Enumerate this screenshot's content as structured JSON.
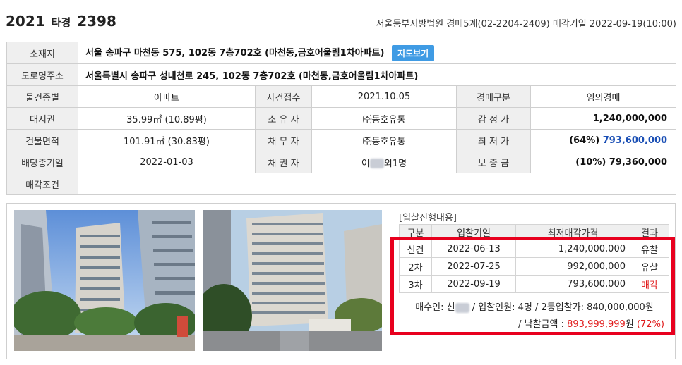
{
  "header": {
    "case_year": "2021",
    "case_type": "타경",
    "case_no": "2398",
    "court_info": "서울동부지방법원 경매5계(02-2204-2409) 매각기일 2022-09-19(10:00)"
  },
  "info": {
    "address_label": "소재지",
    "address": "서울 송파구 마천동 575, 102동 7층702호 (마천동,금호어울림1차아파트)",
    "map_button": "지도보기",
    "road_label": "도로명주소",
    "road_address": "서울특별시 송파구 성내천로 245, 102동 7층702호 (마천동,금호어울림1차아파트)",
    "row3": [
      "물건종별",
      "아파트",
      "사건접수",
      "2021.10.05",
      "경매구분",
      "임의경매"
    ],
    "row4": [
      "대지권",
      "35.99㎡ (10.89평)",
      "소 유 자",
      "㈜동호유통",
      "감 정 가",
      "1,240,000,000"
    ],
    "row5": [
      "건물면적",
      "101.91㎡ (30.83평)",
      "채 무 자",
      "㈜동호유통",
      "최 저 가",
      "(64%)",
      "793,600,000"
    ],
    "row6": [
      "배당종기일",
      "2022-01-03",
      "채 권 자",
      "이",
      "외1명",
      "보 증 금",
      "(10%) 79,360,000"
    ],
    "sale_cond_label": "매각조건",
    "sale_cond_value": ""
  },
  "bid": {
    "title": "[입찰진행내용]",
    "headers": [
      "구분",
      "입찰기일",
      "최저매각가격",
      "결과"
    ],
    "rows": [
      [
        "신건",
        "2022-06-13",
        "1,240,000,000",
        "유찰"
      ],
      [
        "2차",
        "2022-07-25",
        "992,000,000",
        "유찰"
      ],
      [
        "3차",
        "2022-09-19",
        "793,600,000",
        "매각"
      ]
    ],
    "buyer_prefix": "매수인: 신",
    "buyer_rest": " / 입찰인원: 4명 / 2등입찰가: 840,000,000원",
    "price_prefix": "/ 낙찰금액 : ",
    "price_value": "893,999,999",
    "price_unit": "원",
    "price_pct": "(72%)"
  },
  "colors": {
    "accent_blue": "#3f9be4",
    "highlight_red": "#e8001e",
    "sold_red": "#e01a1a",
    "min_price_blue": "#1a4fb5"
  }
}
